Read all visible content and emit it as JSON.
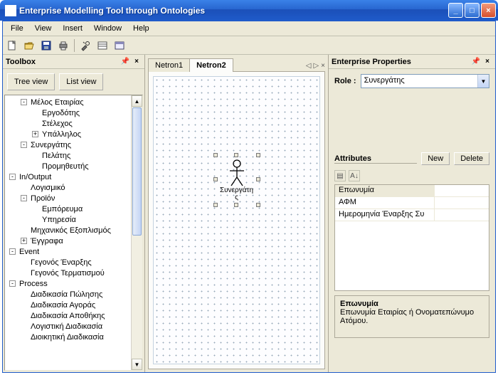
{
  "window": {
    "title": "Enterprise Modelling Tool through Ontologies"
  },
  "menu": {
    "file": "File",
    "view": "View",
    "insert": "Insert",
    "window": "Window",
    "help": "Help"
  },
  "toolbox": {
    "title": "Toolbox",
    "treeview_btn": "Tree view",
    "listview_btn": "List view",
    "tree": [
      {
        "indent": 1,
        "toggle": "-",
        "label": "Μέλος Εταιρίας"
      },
      {
        "indent": 2,
        "toggle": "",
        "label": "Εργοδότης"
      },
      {
        "indent": 2,
        "toggle": "",
        "label": "Στέλεχος"
      },
      {
        "indent": 2,
        "toggle": "+",
        "label": "Υπάλληλος"
      },
      {
        "indent": 1,
        "toggle": "-",
        "label": "Συνεργάτης"
      },
      {
        "indent": 2,
        "toggle": "",
        "label": "Πελάτης"
      },
      {
        "indent": 2,
        "toggle": "",
        "label": "Προμηθευτής"
      },
      {
        "indent": 0,
        "toggle": "-",
        "label": "In/Output"
      },
      {
        "indent": 1,
        "toggle": "",
        "label": "Λογισμικό"
      },
      {
        "indent": 1,
        "toggle": "-",
        "label": "Προϊόν"
      },
      {
        "indent": 2,
        "toggle": "",
        "label": "Εμπόρευμα"
      },
      {
        "indent": 2,
        "toggle": "",
        "label": "Υπηρεσία"
      },
      {
        "indent": 1,
        "toggle": "",
        "label": "Μηχανικός Εξοπλισμός"
      },
      {
        "indent": 1,
        "toggle": "+",
        "label": "Έγγραφα"
      },
      {
        "indent": 0,
        "toggle": "-",
        "label": "Event"
      },
      {
        "indent": 1,
        "toggle": "",
        "label": "Γεγονός Έναρξης"
      },
      {
        "indent": 1,
        "toggle": "",
        "label": "Γεγονός Τερματισμού"
      },
      {
        "indent": 0,
        "toggle": "-",
        "label": "Process"
      },
      {
        "indent": 1,
        "toggle": "",
        "label": "Διαδικασία Πώλησης"
      },
      {
        "indent": 1,
        "toggle": "",
        "label": "Διαδικασία Αγοράς"
      },
      {
        "indent": 1,
        "toggle": "",
        "label": "Διαδικασία Αποθήκης"
      },
      {
        "indent": 1,
        "toggle": "",
        "label": "Λογιστική Διαδικασία"
      },
      {
        "indent": 1,
        "toggle": "",
        "label": "Διοικητική Διαδικασία"
      }
    ]
  },
  "center": {
    "tabs": [
      {
        "label": "Netron1",
        "active": false
      },
      {
        "label": "Netron2",
        "active": true
      }
    ],
    "actor_label": "Συνεργάτης"
  },
  "props": {
    "title": "Enterprise Properties",
    "role_label": "Role :",
    "role_value": "Συνεργάτης",
    "attributes_label": "Attributes",
    "new_btn": "New",
    "delete_btn": "Delete",
    "grid": [
      {
        "k": "Επωνυμία",
        "v": "",
        "selected": true
      },
      {
        "k": "ΑΦΜ",
        "v": "",
        "selected": false
      },
      {
        "k": "Ημερομηνία Έναρξης Συ",
        "v": "",
        "selected": false
      }
    ],
    "desc_title": "Επωνυμία",
    "desc_text": "Επωνυμία Εταιρίας ή Ονοματεπώνυμο Ατόμου."
  }
}
